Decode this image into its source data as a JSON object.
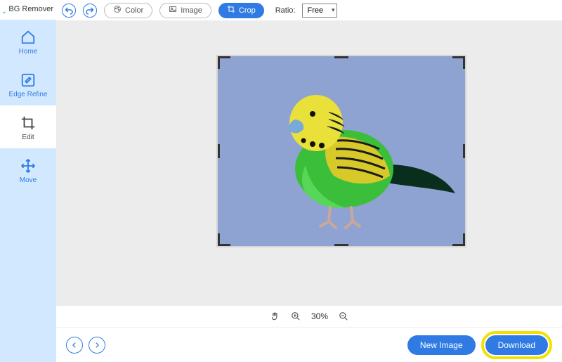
{
  "brand": {
    "name": "BG Remover"
  },
  "sidebar": {
    "items": [
      {
        "label": "Home"
      },
      {
        "label": "Edge Refine"
      },
      {
        "label": "Edit"
      },
      {
        "label": "Move"
      }
    ]
  },
  "toolbar": {
    "color_label": "Color",
    "image_label": "Image",
    "crop_label": "Crop",
    "ratio_label": "Ratio:",
    "ratio_value": "Free"
  },
  "zoom": {
    "value": "30%"
  },
  "bottom": {
    "new_image_label": "New Image",
    "download_label": "Download"
  },
  "canvas": {
    "subject": "green-yellow-parakeet",
    "background_color": "#8ea3d1"
  }
}
